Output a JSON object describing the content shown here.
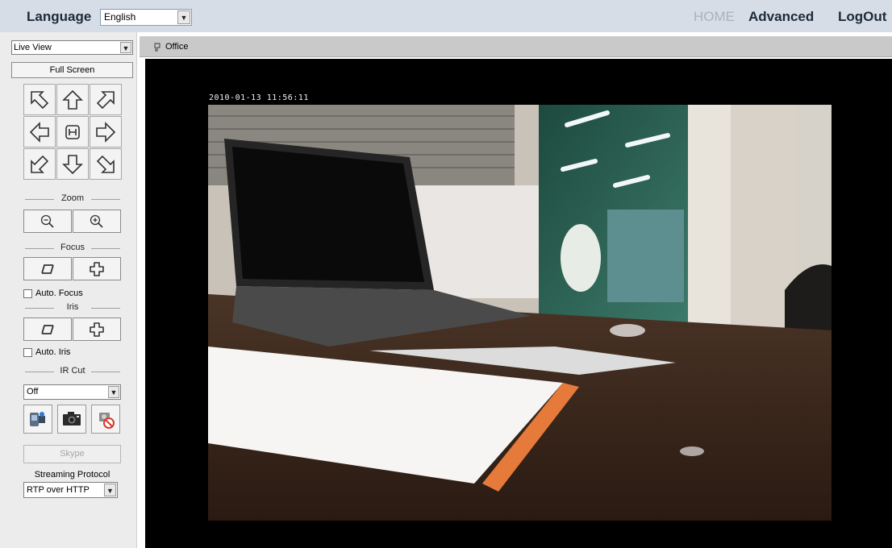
{
  "header": {
    "language_label": "Language",
    "language_value": "English",
    "nav": {
      "home": "HOME",
      "advanced": "Advanced",
      "logout": "LogOut"
    }
  },
  "sidebar": {
    "view_mode": "Live View",
    "full_screen": "Full Screen",
    "zoom_label": "Zoom",
    "focus_label": "Focus",
    "auto_focus_label": "Auto. Focus",
    "iris_label": "Iris",
    "auto_iris_label": "Auto. Iris",
    "ircut_label": "IR Cut",
    "ircut_value": "Off",
    "skype_label": "Skype",
    "streaming_label": "Streaming Protocol",
    "streaming_value": "RTP over HTTP"
  },
  "camera": {
    "name": "Office",
    "timestamp": "2010-01-13 11:56:11"
  },
  "icons": {
    "ptz": [
      "arrow-up-left-icon",
      "arrow-up-icon",
      "arrow-up-right-icon",
      "arrow-left-icon",
      "home-icon",
      "arrow-right-icon",
      "arrow-down-left-icon",
      "arrow-down-icon",
      "arrow-down-right-icon"
    ],
    "zoom": [
      "zoom-out-icon",
      "zoom-in-icon"
    ],
    "tools": [
      "video-record-icon",
      "snapshot-icon",
      "stop-icon"
    ]
  },
  "colors": {
    "header_bg": "#d6dde6",
    "sidebar_bg": "#ececec",
    "nav_inactive": "#a8b3c1",
    "nav_active": "#1d2a3a"
  }
}
